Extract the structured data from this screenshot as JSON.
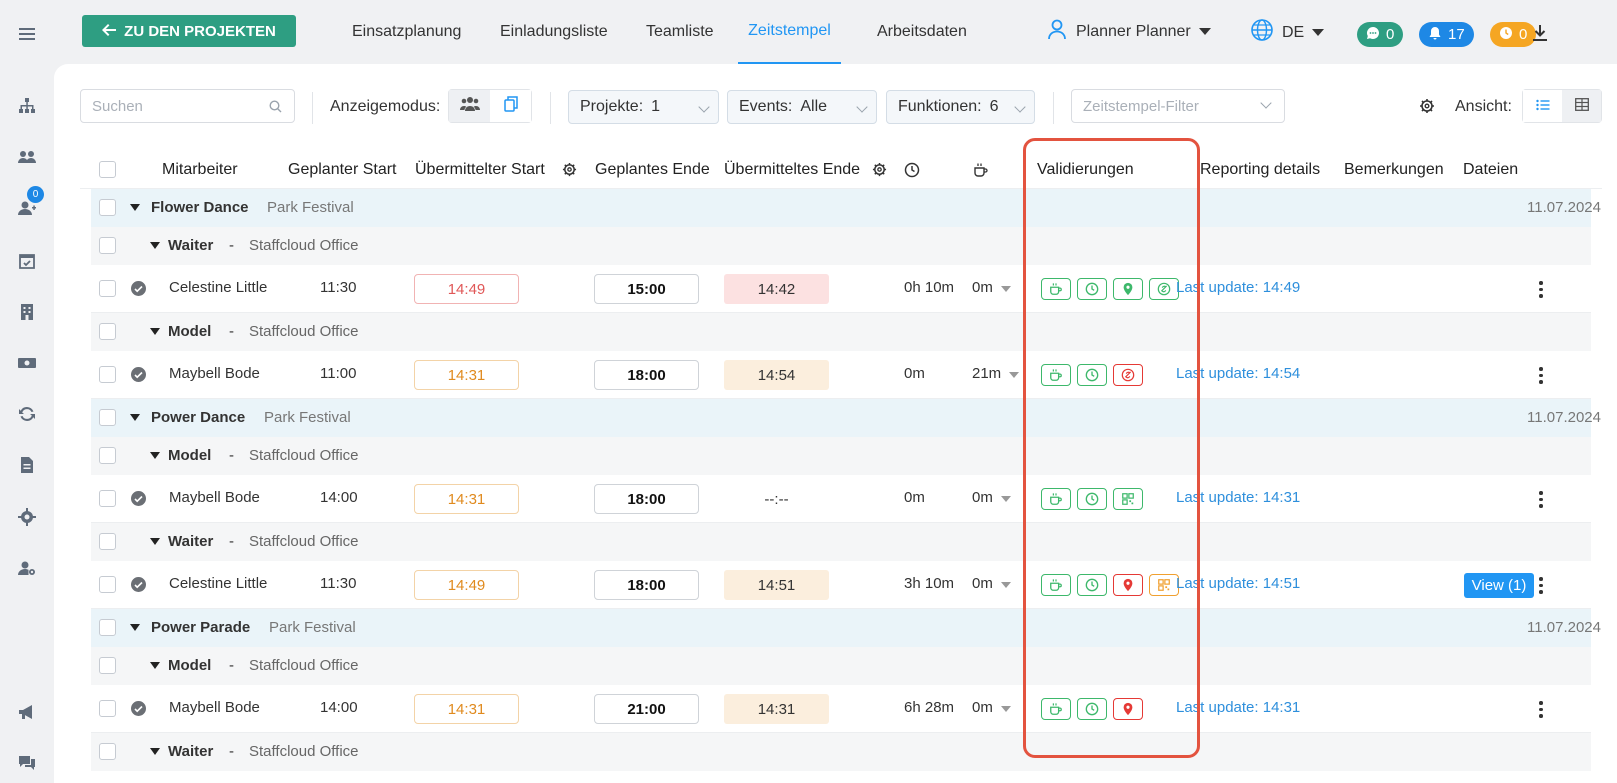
{
  "topbar": {
    "back_label": "ZU DEN PROJEKTEN",
    "tabs": [
      "Einsatzplanung",
      "Einladungsliste",
      "Teamliste",
      "Zeitstempel",
      "Arbeitsdaten"
    ],
    "active_tab": "Zeitstempel",
    "user": "Planner Planner",
    "lang": "DE",
    "chat_count": "0",
    "notif_count": "17",
    "pending_count": "0",
    "colors": {
      "chat": "#2e9e82",
      "notif": "#1e88e5",
      "pending": "#f5a623",
      "accent": "#2196f3"
    }
  },
  "sidebar": {
    "badge": "0"
  },
  "toolbar": {
    "search_placeholder": "Suchen",
    "mode_label": "Anzeigemodus:",
    "projekte_label": "Projekte:",
    "projekte_value": "1",
    "events_label": "Events:",
    "events_value": "Alle",
    "funktionen_label": "Funktionen:",
    "funktionen_value": "6",
    "filter_placeholder": "Zeitstempel-Filter",
    "ansicht_label": "Ansicht:"
  },
  "columns": {
    "mitarbeiter": "Mitarbeiter",
    "geplanter_start": "Geplanter Start",
    "uebermittelter_start": "Übermittelter Start",
    "geplantes_ende": "Geplantes Ende",
    "uebermitteltes_ende": "Übermitteltes Ende",
    "validierungen": "Validierungen",
    "reporting": "Reporting details",
    "bemerkungen": "Bemerkungen",
    "dateien": "Dateien"
  },
  "groups": [
    {
      "event": "Flower Dance",
      "location": "Park Festival",
      "date": "11.07.2024"
    },
    {
      "func": "Waiter",
      "sep": "-",
      "office": "Staffcloud Office"
    },
    {
      "name": "Celestine Little",
      "planned_start": "11:30",
      "sent_start": "14:49",
      "planned_end": "15:00",
      "sent_end": "14:42",
      "duration": "0h 10m",
      "brk": "0m",
      "update": "Last update: 14:49"
    },
    {
      "func": "Model",
      "sep": "-",
      "office": "Staffcloud Office"
    },
    {
      "name": "Maybell Bode",
      "planned_start": "11:00",
      "sent_start": "14:31",
      "planned_end": "18:00",
      "sent_end": "14:54",
      "duration": "0m",
      "brk": "21m",
      "update": "Last update: 14:54"
    },
    {
      "event": "Power Dance",
      "location": "Park Festival",
      "date": "11.07.2024"
    },
    {
      "func": "Model",
      "sep": "-",
      "office": "Staffcloud Office"
    },
    {
      "name": "Maybell Bode",
      "planned_start": "14:00",
      "sent_start": "14:31",
      "planned_end": "18:00",
      "sent_end": "--:--",
      "duration": "0m",
      "brk": "0m",
      "update": "Last update: 14:31"
    },
    {
      "func": "Waiter",
      "sep": "-",
      "office": "Staffcloud Office"
    },
    {
      "name": "Celestine Little",
      "planned_start": "11:30",
      "sent_start": "14:49",
      "planned_end": "18:00",
      "sent_end": "14:51",
      "duration": "3h 10m",
      "brk": "0m",
      "update": "Last update: 14:51",
      "files": "View (1)"
    },
    {
      "event": "Power Parade",
      "location": "Park Festival",
      "date": "11.07.2024"
    },
    {
      "func": "Model",
      "sep": "-",
      "office": "Staffcloud Office"
    },
    {
      "name": "Maybell Bode",
      "planned_start": "14:00",
      "sent_start": "14:31",
      "planned_end": "21:00",
      "sent_end": "14:31",
      "duration": "6h 28m",
      "brk": "0m",
      "update": "Last update: 14:31"
    },
    {
      "func": "Waiter",
      "sep": "-",
      "office": "Staffcloud Office"
    }
  ]
}
